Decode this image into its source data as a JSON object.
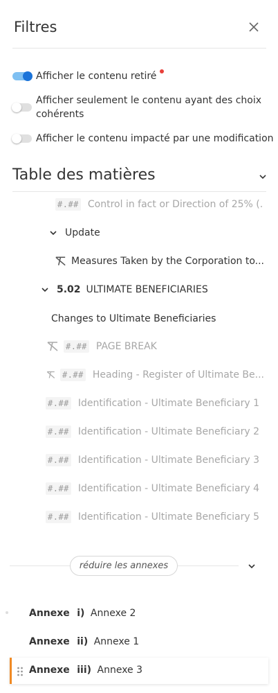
{
  "header": {
    "title": "Filtres"
  },
  "filters": [
    {
      "label": "Afficher le contenu retiré",
      "on": true,
      "has_dot": true
    },
    {
      "label_line1": "Afficher seulement le contenu ayant des choix",
      "label_line2": "cohérents",
      "on": false
    },
    {
      "label": "Afficher le contenu impacté par une modification",
      "on": false
    }
  ],
  "toc": {
    "title": "Table des matières",
    "items": [
      {
        "badge": "#.##",
        "label": "Control in fact or Direction of 25% (..."
      },
      {
        "label": "Update"
      },
      {
        "label": "Measures Taken by the Corporation to..."
      },
      {
        "number": "5.02",
        "label": "ULTIMATE BENEFICIARIES"
      },
      {
        "label": "Changes to Ultimate Beneficiaries"
      },
      {
        "badge": "#.##",
        "label": "PAGE BREAK"
      },
      {
        "badge": "#.##",
        "label": "Heading - Register of Ultimate Be..."
      },
      {
        "badge": "#.##",
        "label": "Identification - Ultimate Beneficiary 1"
      },
      {
        "badge": "#.##",
        "label": "Identification - Ultimate Beneficiary 2"
      },
      {
        "badge": "#.##",
        "label": "Identification - Ultimate Beneficiary 3"
      },
      {
        "badge": "#.##",
        "label": "Identification - Ultimate Beneficiary 4"
      },
      {
        "badge": "#.##",
        "label": "Identification - Ultimate Beneficiary 5"
      }
    ]
  },
  "annexes": {
    "collapse_label": "réduire les annexes",
    "items": [
      {
        "prefix": "Annexe",
        "numeral": "i)",
        "name": "Annexe 2"
      },
      {
        "prefix": "Annexe",
        "numeral": "ii)",
        "name": "Annexe 1"
      },
      {
        "prefix": "Annexe",
        "numeral": "iii)",
        "name": "Annexe 3"
      }
    ]
  },
  "colors": {
    "accent": "#1a73d9",
    "selected_border": "#f08a24",
    "dot": "#e8403a"
  }
}
